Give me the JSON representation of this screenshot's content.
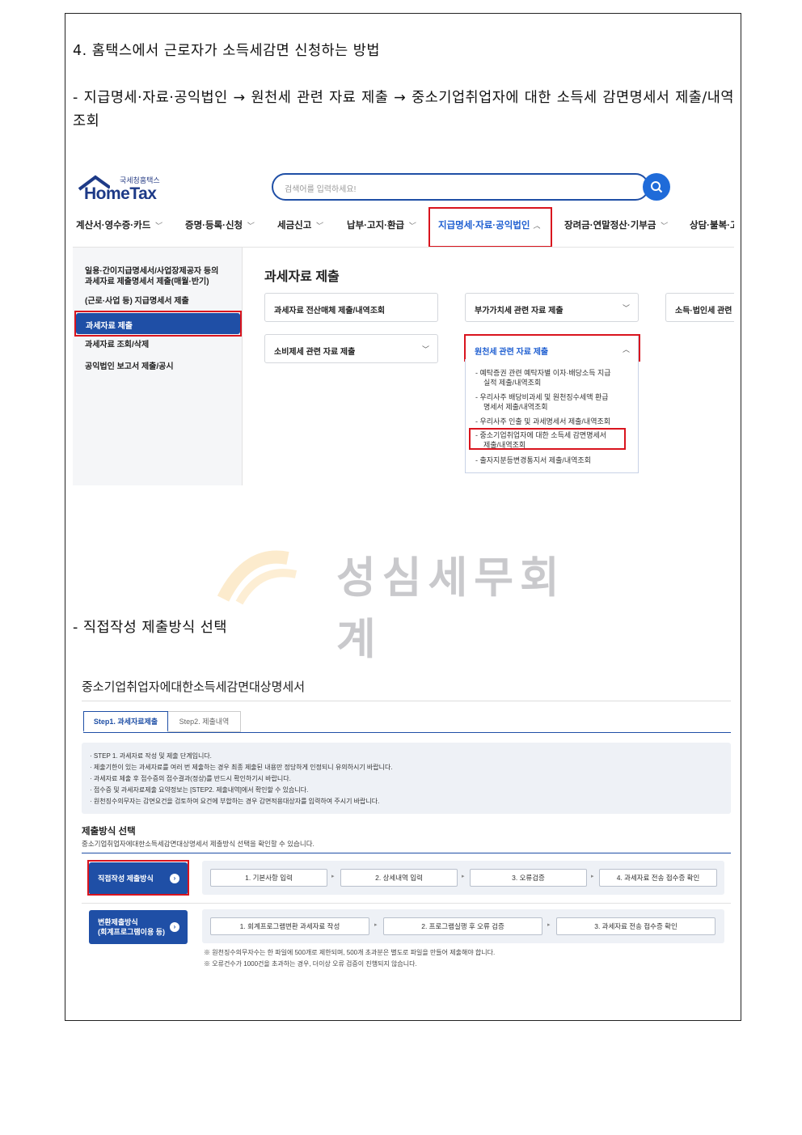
{
  "doc": {
    "heading": "4. 홈택스에서 근로자가 소득세감면 신청하는 방법",
    "path": "- 지급명세·자료·공익법인 → 원천세 관련 자료 제출 → 중소기업취업자에 대한 소득세 감면명세서 제출/내역조회",
    "direct": "- 직접작성 제출방식 선택"
  },
  "hometax": {
    "logo_small": "국세청홈택스",
    "logo_text": "HomeTax",
    "search_placeholder": "검색어를 입력하세요!",
    "menu": [
      "계산서·영수증·카드",
      "증명·등록·신청",
      "세금신고",
      "납부·고지·환급",
      "지급명세·자료·공익법인",
      "장려금·연말정산·기부금",
      "상담·불복·고"
    ],
    "sidebar": [
      "일용·간이지급명세서/사업장제공자 등의",
      "과세자료 제출명세서 제출(매월·반기)",
      "(근로·사업 등) 지급명세서 제출",
      "과세자료 제출",
      "과세자료 조회/삭제",
      "공익법인 보고서 제출/공시"
    ],
    "section_title": "과세자료 제출",
    "cards": [
      "과세자료 전산매체 제출/내역조회",
      "부가가치세 관련 자료 제출",
      "소득·법인세 관련",
      "소비제세 관련 자료 제출",
      "원천세 관련 자료 제출"
    ],
    "dropdown": [
      "- 예탁증권 관련 예탁자별 이자·배당소득 지급",
      "실적 제출/내역조회",
      "- 우리사주 배당비과세 및 원천징수세액 환급",
      "명세서 제출/내역조회",
      "- 우리사주 인출 및 과세명세서 제출/내역조회",
      "- 중소기업취업자에 대한 소득세 감면명세서",
      "제출/내역조회",
      "- 출자지분등변경통지서 제출/내역조회"
    ]
  },
  "watermark": "성심세무회계",
  "form": {
    "title": "중소기업취업자에대한소득세감면대상명세서",
    "tab1": "Step1. 과세자료제출",
    "tab2": "Step2. 제출내역",
    "info": [
      "· STEP 1. 과세자료 작성 및 제출 단계입니다.",
      "· 제출기한이 있는 과세자료를 여러 번 제출하는 경우 최종 제출된 내용만 정당하게 인정되니 유의하시기 바랍니다.",
      "· 과세자료 제출 후 접수증의 접수결과(정상)를 반드시 확인하기시 바랍니다.",
      "· 접수증 및 과세자료제출 요약정보는 [STEP2. 제출내역]에서 확인할 수 있습니다.",
      "· 원천징수의무자는 감면요건을 검토하여 요건에 부합하는 경우 감면적용대상자를 입력하여 주시기 바랍니다."
    ],
    "method_title": "제출방식 선택",
    "method_sub": "중소기업취업자에대한소득세감면대상명세서 제출방식 선택을 확인할 수 있습니다.",
    "direct_btn": "직접작성 제출방식",
    "convert_btn_l1": "변환제출방식",
    "convert_btn_l2": "(회계프로그램이용 등)",
    "direct_steps": [
      "1. 기본사항 입력",
      "2. 상세내역 입력",
      "3. 오류검증",
      "4. 과세자료 전송 접수증 확인"
    ],
    "convert_steps": [
      "1. 회계프로그램변환 과세자료 작성",
      "2. 프로그램실행 후 오류 검증",
      "3. 과세자료 전송 접수증 확인"
    ],
    "notes": [
      "※ 원천징수의무자수는 한 파일에 500개로 제한되며, 500개 초과분은 별도로 파일을 만들어 제출해야 합니다.",
      "※ 오류건수가 1000건을 초과하는 경우, 더이상 오류 검증이 진행되지 않습니다."
    ]
  },
  "colors": {
    "brand_blue": "#1f4fa6",
    "highlight_red": "#d9141e"
  }
}
